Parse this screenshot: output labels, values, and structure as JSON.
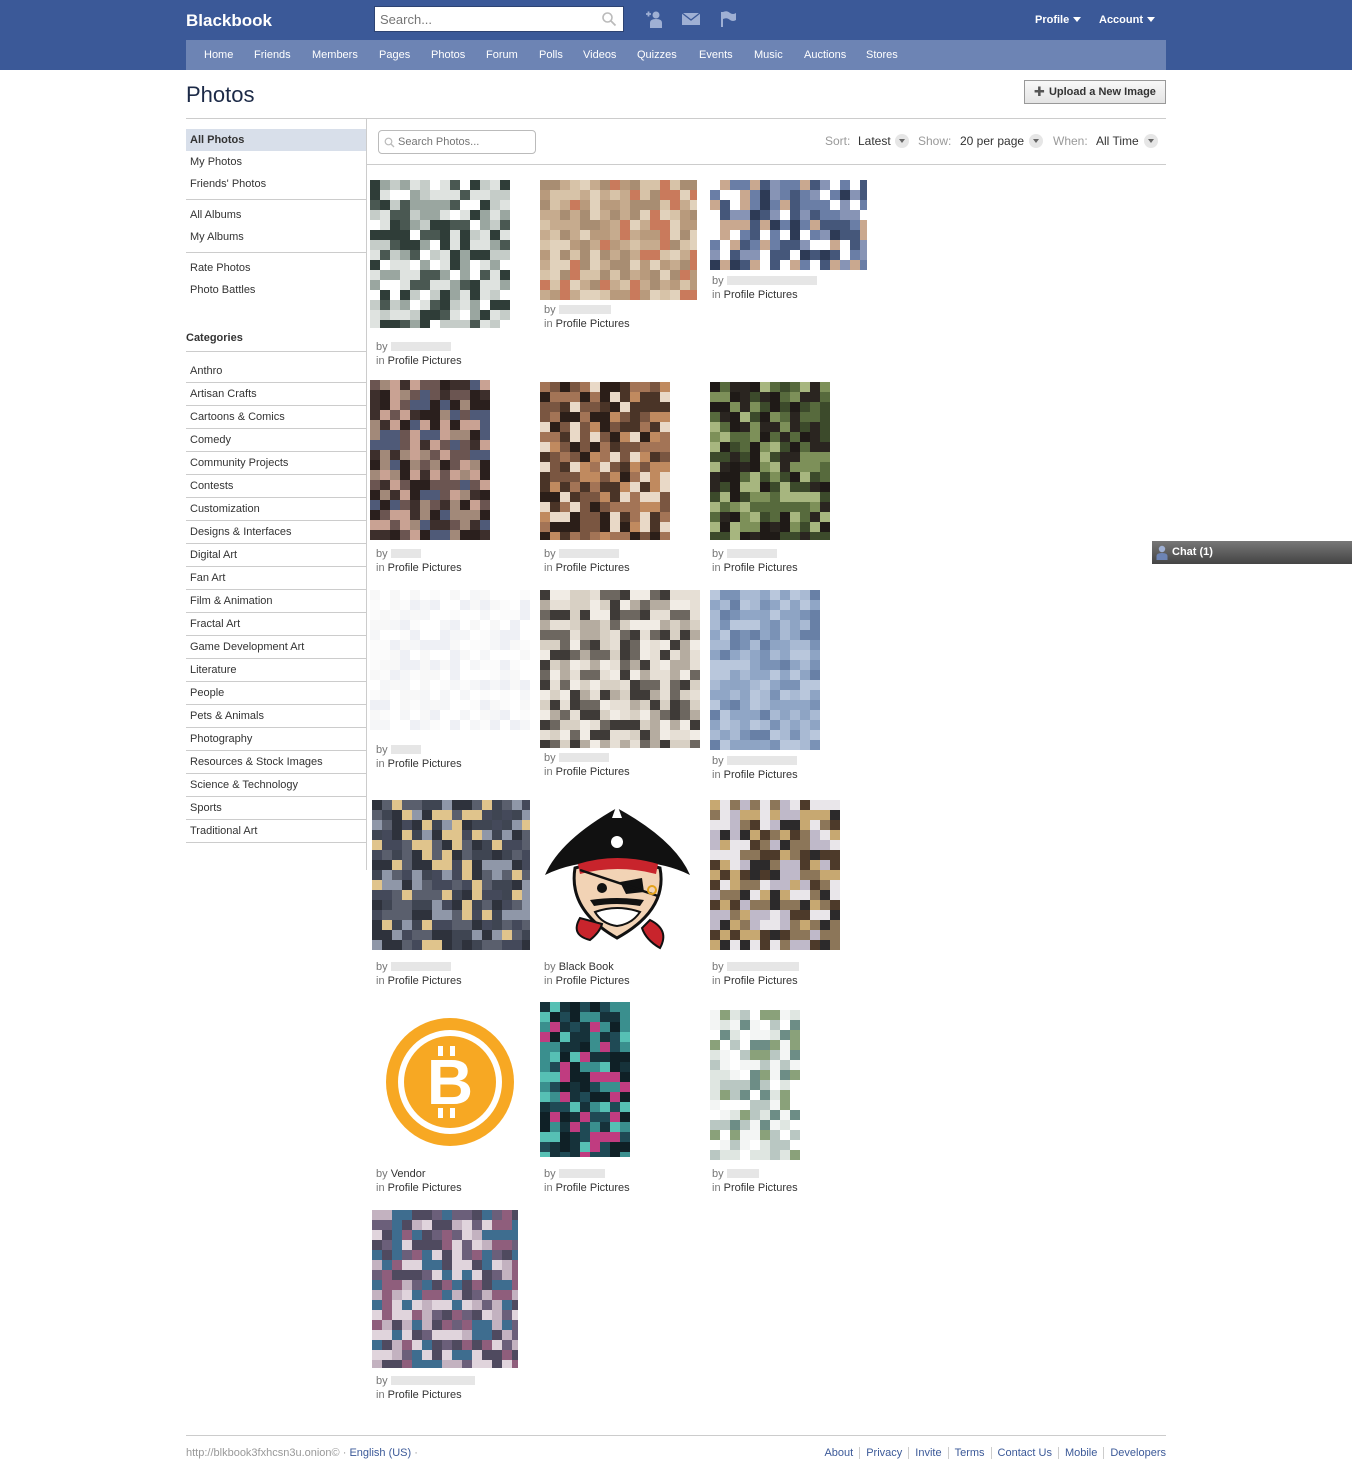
{
  "header": {
    "logo": "Blackbook",
    "search_placeholder": "Search...",
    "profile_label": "Profile",
    "account_label": "Account",
    "brand_color": "#3b5998"
  },
  "nav": [
    "Home",
    "Friends",
    "Members",
    "Pages",
    "Photos",
    "Forum",
    "Polls",
    "Videos",
    "Quizzes",
    "Events",
    "Music",
    "Auctions",
    "Stores"
  ],
  "page": {
    "title": "Photos",
    "upload_label": "Upload a New Image"
  },
  "sidebar": {
    "group1": [
      "All Photos",
      "My Photos",
      "Friends' Photos"
    ],
    "group2": [
      "All Albums",
      "My Albums"
    ],
    "group3": [
      "Rate Photos",
      "Photo Battles"
    ],
    "categories_title": "Categories",
    "categories": [
      "Anthro",
      "Artisan Crafts",
      "Cartoons & Comics",
      "Comedy",
      "Community Projects",
      "Contests",
      "Customization",
      "Designs & Interfaces",
      "Digital Art",
      "Fan Art",
      "Film & Animation",
      "Fractal Art",
      "Game Development Art",
      "Literature",
      "People",
      "Pets & Animals",
      "Photography",
      "Resources & Stock Images",
      "Science & Technology",
      "Sports",
      "Traditional Art"
    ]
  },
  "filters": {
    "search_placeholder": "Search Photos...",
    "sort_label": "Sort:",
    "sort_value": "Latest",
    "show_label": "Show:",
    "show_value": "20 per page",
    "when_label": "When:",
    "when_value": "All Time"
  },
  "photo_caption": {
    "by": "by",
    "in": "in",
    "album": "Profile Pictures"
  },
  "photos": [
    {
      "author": "",
      "album": "Profile Pictures"
    },
    {
      "author": "",
      "album": "Profile Pictures"
    },
    {
      "author": "",
      "album": "Profile Pictures"
    },
    {
      "author": "",
      "album": "Profile Pictures"
    },
    {
      "author": "",
      "album": "Profile Pictures"
    },
    {
      "author": "",
      "album": "Profile Pictures"
    },
    {
      "author": "",
      "album": "Profile Pictures"
    },
    {
      "author": "",
      "album": "Profile Pictures"
    },
    {
      "author": "",
      "album": "Profile Pictures"
    },
    {
      "author": "",
      "album": "Profile Pictures"
    },
    {
      "author": "Black Book",
      "album": "Profile Pictures"
    },
    {
      "author": "",
      "album": "Profile Pictures"
    },
    {
      "author": "Vendor",
      "album": "Profile Pictures"
    },
    {
      "author": "",
      "album": "Profile Pictures"
    },
    {
      "author": "",
      "album": "Profile Pictures"
    },
    {
      "author": "",
      "album": "Profile Pictures"
    }
  ],
  "chat": {
    "label": "Chat (1)"
  },
  "footer": {
    "left_text": "http://blkbook3fxhcsn3u.onion© · ",
    "language": "English (US)",
    "language_suffix": " ·",
    "links": [
      "About",
      "Privacy",
      "Invite",
      "Terms",
      "Contact Us",
      "Mobile",
      "Developers"
    ]
  }
}
